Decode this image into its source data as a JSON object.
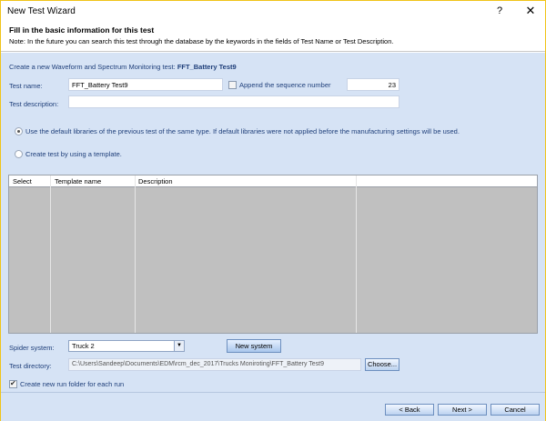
{
  "window": {
    "title": "New Test Wizard",
    "help_label": "?",
    "close_label": "✕"
  },
  "header": {
    "title": "Fill in the basic information for this test",
    "note": "Note: In the future you can search this test through the database by the keywords in the fields of Test Name or Test Description."
  },
  "form": {
    "create_prefix": "Create a new Waveform and Spectrum Monitoring test: ",
    "create_name": "FFT_Battery Test9",
    "test_name_label": "Test name:",
    "test_name_value": "FFT_Battery Test9",
    "append_label": "Append the sequence number",
    "append_checked": false,
    "sequence_value": "23",
    "test_description_label": "Test description:",
    "test_description_value": "",
    "radio_default_label": "Use the default libraries of the previous test of the same type. If default libraries were not applied before the manufacturing settings will be used.",
    "radio_default_selected": true,
    "radio_template_label": "Create test by using a template.",
    "radio_template_selected": false
  },
  "template_table": {
    "columns": [
      "Select",
      "Template name",
      "Description"
    ],
    "rows": []
  },
  "system": {
    "spider_label": "Spider system:",
    "spider_value": "Truck 2",
    "new_system_label": "New system",
    "test_dir_label": "Test directory:",
    "test_dir_value": "C:\\Users\\Sandeep\\Documents\\EDM\\rcm_dec_2017\\Trucks Moniroting\\FFT_Battery Test9",
    "choose_label": "Choose...",
    "run_folder_label": "Create new run folder for each run",
    "run_folder_checked": true
  },
  "footer": {
    "back_label": "< Back",
    "next_label": "Next >",
    "cancel_label": "Cancel"
  }
}
